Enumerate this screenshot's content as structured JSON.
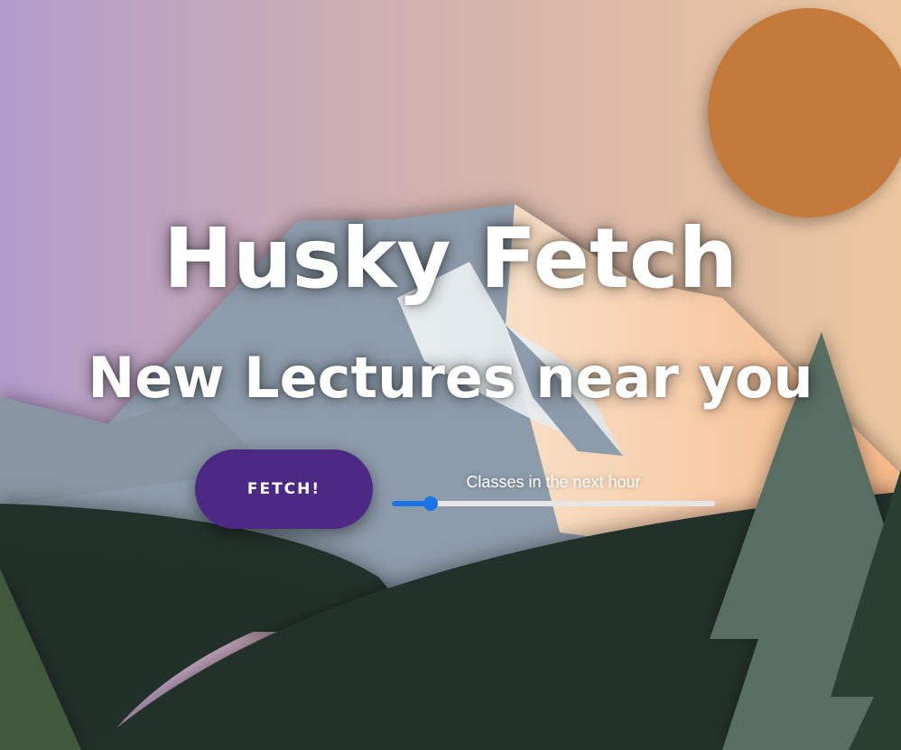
{
  "hero": {
    "title": "Husky Fetch",
    "subtitle": "New Lectures near you"
  },
  "controls": {
    "fetch_label": "FETCH!",
    "slider_label": "Classes in the next hour",
    "slider_value_fraction": 0.12
  },
  "colors": {
    "sky_left": "#b39ccb",
    "sky_right": "#f2c291",
    "sun": "#c47a3b",
    "button": "#4b2984",
    "slider_accent": "#1a73e8",
    "hills": "#22302a",
    "tree_light": "#596e62"
  }
}
